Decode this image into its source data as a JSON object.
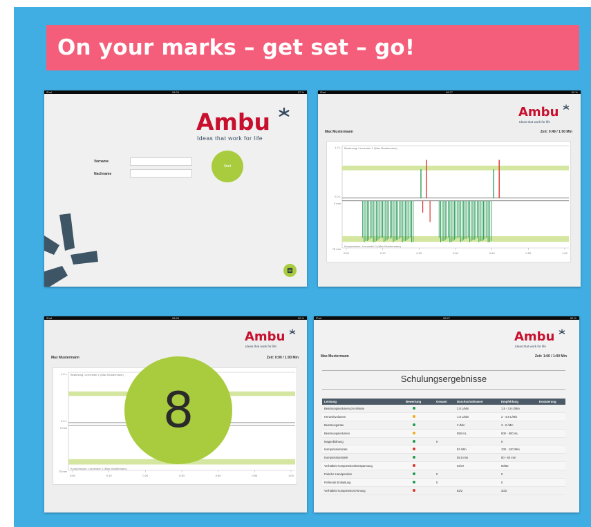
{
  "headline": "On your marks – get set – go!",
  "status_bar": {
    "screen1": {
      "left": "iPad",
      "time": "08:26",
      "right": "57 %"
    },
    "screen2": {
      "left": "iPad",
      "time": "08:27",
      "right": "50 %"
    },
    "screen3": {
      "left": "iPad",
      "time": "08:26",
      "right": "50 %"
    },
    "screen4": {
      "left": "iPad",
      "time": "08:27",
      "right": "50 %"
    }
  },
  "brand": {
    "word": "Ambu",
    "tagline": "Ideas that work for life",
    "color": "#c8102e"
  },
  "login": {
    "vorname_label": "Vorname",
    "nachname_label": "Nachname",
    "vorname_value": "",
    "nachname_value": "",
    "start_label": "Start",
    "menu_icon": "list-icon"
  },
  "training": {
    "user": "Max Mustermann",
    "time_running": "Zeit: 0:49 / 1:00 Min",
    "time_start": "Zeit: 0:00 / 1:00 Min",
    "vent_label": "Beatmung: Lernender 1 (Max Mustermann)",
    "comp_label": "Kompression: Lernender 1 (Max Mustermann)",
    "vent_axis_top": "1.2 L",
    "vent_axis_zero": "0.0 L",
    "comp_axis_zero": "0 mm",
    "comp_axis_bottom": "75 mm",
    "time_ticks": [
      "0:00",
      "0:10",
      "0:20",
      "0:30",
      "0:40",
      "0:50",
      "1:00"
    ],
    "countdown": "8"
  },
  "results": {
    "user": "Max Mustermann",
    "time": "Zeit: 1:00 / 1:00 Min",
    "title": "Schulungsergebnisse",
    "columns": [
      "Leistung",
      "Bewertung",
      "Gesamt",
      "Durchschnittswert",
      "Empfehlung",
      "Evaluierung"
    ],
    "rows": [
      {
        "name": "Beatmungsvolumen pro Minute",
        "rating": "green",
        "total": "",
        "avg": "2.8 L/Min",
        "rec": "1.5 - 3.6 L/Min"
      },
      {
        "name": "Herzzeitvolumen",
        "rating": "orange",
        "total": "",
        "avg": "1.8 L/Min",
        "rec": "2 - 4.8 L/Min"
      },
      {
        "name": "Beatmungsrate",
        "rating": "green",
        "total": "",
        "avg": "3 /Min",
        "rec": "3 - 6 /Min"
      },
      {
        "name": "Beatmungsvolumen",
        "rating": "orange",
        "total": "",
        "avg": "550 mL",
        "rec": "500 - 600 mL"
      },
      {
        "name": "Magenblähung",
        "rating": "green",
        "total": "0",
        "avg": "",
        "rec": "0"
      },
      {
        "name": "Kompressionsrate",
        "rating": "red",
        "total": "",
        "avg": "82 /Min",
        "rec": "100 - 120 /Min"
      },
      {
        "name": "Kompressionstiefe",
        "rating": "green",
        "total": "",
        "avg": "55.5 mm",
        "rec": "50 - 60 mm"
      },
      {
        "name": "Verhältnis Kompression/Entspannung",
        "rating": "red",
        "total": "",
        "avg": "63/37",
        "rec": "50/50"
      },
      {
        "name": "Falsche Handposition",
        "rating": "green",
        "total": "0",
        "avg": "",
        "rec": "0"
      },
      {
        "name": "Fehlende Entlastung",
        "rating": "green",
        "total": "0",
        "avg": "",
        "rec": "0"
      },
      {
        "name": "Verhältnis Kompression/Atmung",
        "rating": "red",
        "total": "",
        "avg": "62/2",
        "rec": "30/2"
      }
    ]
  },
  "colors": {
    "background": "#40aee3",
    "headline_bg": "#f45e7a",
    "green_circle": "#a8cc3e",
    "target_band": "#d4e6a0",
    "compression_bar": "#2e9e5c",
    "vent_bar_red": "#d9342b",
    "rating_green": "#1e9a4e",
    "rating_orange": "#f3a91a",
    "rating_red": "#d9342b"
  }
}
